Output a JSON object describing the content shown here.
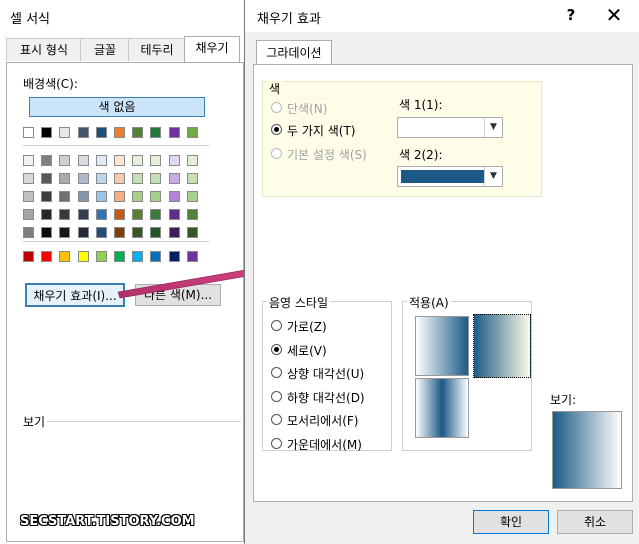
{
  "back_dialog": {
    "title": "셀 서식",
    "tabs": [
      "표시 형식",
      "글꼴",
      "테두리",
      "채우기"
    ],
    "bg_color_label": "배경색(C):",
    "no_color_button": "색 없음",
    "fill_effects_button": "채우기 효과(I)...",
    "more_colors_button": "다른 색(M)...",
    "sample_label": "보기",
    "theme_row": [
      "#ffffff",
      "#000000",
      "#e7e6e6",
      "#44546a",
      "#1f4e79",
      "#ed7d31",
      "#548235",
      "#1f7a3a",
      "#7030a0",
      "#70ad47"
    ],
    "shade_rows": [
      [
        "#f2f2f2",
        "#7f7f7f",
        "#d0cece",
        "#d6dce4",
        "#deebf6",
        "#fbe5d5",
        "#e2efd9",
        "#e2efd9",
        "#e6d5f2",
        "#e2efd9"
      ],
      [
        "#d8d8d8",
        "#595959",
        "#aeabab",
        "#adb9ca",
        "#bdd7ee",
        "#f7caac",
        "#c5e0b3",
        "#c5e0b3",
        "#ccabe5",
        "#c5e0b3"
      ],
      [
        "#bfbfbf",
        "#3f3f3f",
        "#757070",
        "#8496b0",
        "#9dc3e6",
        "#f4b083",
        "#a8d08d",
        "#a8d08d",
        "#b381d8",
        "#a8d08d"
      ],
      [
        "#a5a5a5",
        "#262626",
        "#3a3838",
        "#323f4f",
        "#2e75b5",
        "#c55a11",
        "#538135",
        "#3a7d3a",
        "#5f2c8a",
        "#538135"
      ],
      [
        "#7f7f7f",
        "#0c0c0c",
        "#171616",
        "#222a35",
        "#1e4e79",
        "#833c0b",
        "#375623",
        "#255725",
        "#3f1d5c",
        "#375623"
      ]
    ],
    "standard_row": [
      "#c00000",
      "#ff0000",
      "#ffc000",
      "#ffff00",
      "#92d050",
      "#00b050",
      "#00b0f0",
      "#0070c0",
      "#002060",
      "#7030a0"
    ]
  },
  "fill_effects": {
    "title": "채우기 효과",
    "help": "?",
    "close": "✕",
    "tab": "그라데이션",
    "colors_group": "색",
    "opt_one_color": "단색(N)",
    "opt_two_colors": "두 가지 색(T)",
    "opt_preset": "기본 설정 색(S)",
    "color1_label": "색 1(1):",
    "color2_label": "색 2(2):",
    "color2_value": "#1b5a86",
    "shading_group": "음영 스타일",
    "shading_styles": [
      "가로(Z)",
      "세로(V)",
      "상향 대각선(U)",
      "하향 대각선(D)",
      "모서리에서(F)",
      "가운데에서(M)"
    ],
    "selected_style": "세로(V)",
    "variants_group": "적용(A)",
    "sample_label": "보기:",
    "ok_button": "확인",
    "cancel_button": "취소",
    "gradient_dark": "#1b5a86",
    "gradient_light": "#ffffff"
  },
  "watermark": "SECSTART.TISTORY.COM"
}
